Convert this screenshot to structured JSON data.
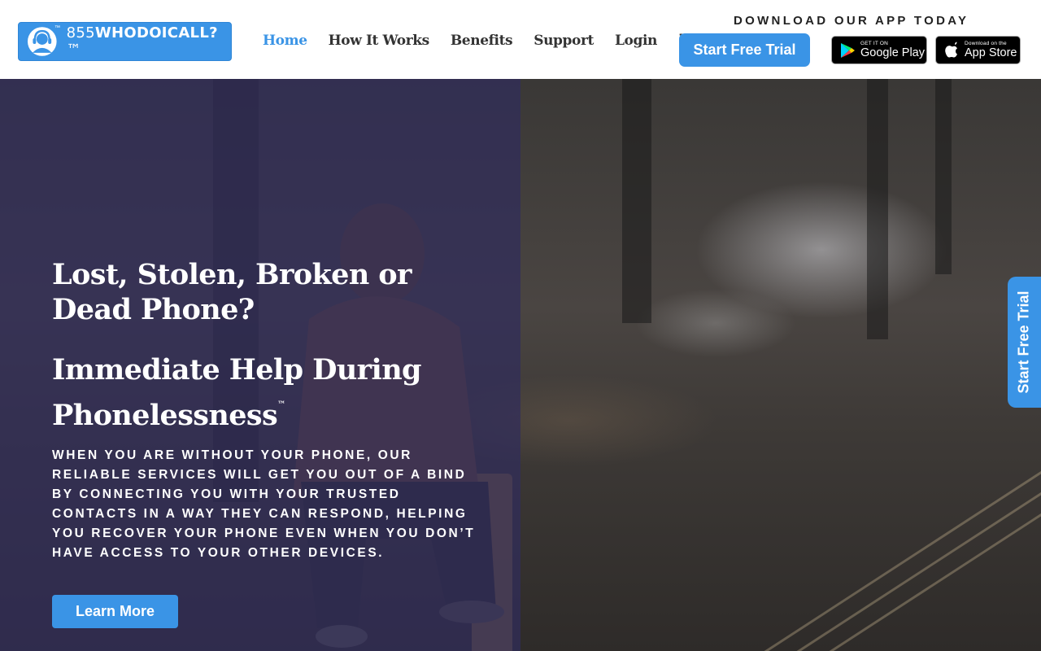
{
  "header": {
    "logo": {
      "tm_mark": "™",
      "text_prefix": "855",
      "text_bold": "WHODOICALL?",
      "text_suffix": "™"
    },
    "nav": [
      {
        "label": "Home",
        "active": true
      },
      {
        "label": "How It Works",
        "active": false
      },
      {
        "label": "Benefits",
        "active": false
      },
      {
        "label": "Support",
        "active": false
      },
      {
        "label": "Login",
        "active": false
      }
    ],
    "menu_icon": "☰",
    "cta_label": "Start Free Trial",
    "download_label": "DOWNLOAD OUR APP TODAY",
    "google_play": {
      "small": "GET IT ON",
      "big": "Google Play",
      "icon": "google-play-icon"
    },
    "app_store": {
      "small": "Download on the",
      "big": "App Store",
      "icon": "apple-icon"
    }
  },
  "hero": {
    "title": "Lost, Stolen, Broken or Dead Phone?",
    "subtitle": "Immediate Help During Phonelessness",
    "subtitle_tm": "™",
    "body": "When you are without your phone, our reliable services will get you out of a bind by connecting you with your trusted contacts in a way they can respond, helping you recover your phone even when you don’t have access to your other devices.",
    "button_label": "Learn More"
  },
  "side_tab": {
    "label": "Start Free Trial"
  },
  "colors": {
    "accent": "#3a94e6",
    "overlay": "#302c5c",
    "text_dark": "#333333"
  }
}
